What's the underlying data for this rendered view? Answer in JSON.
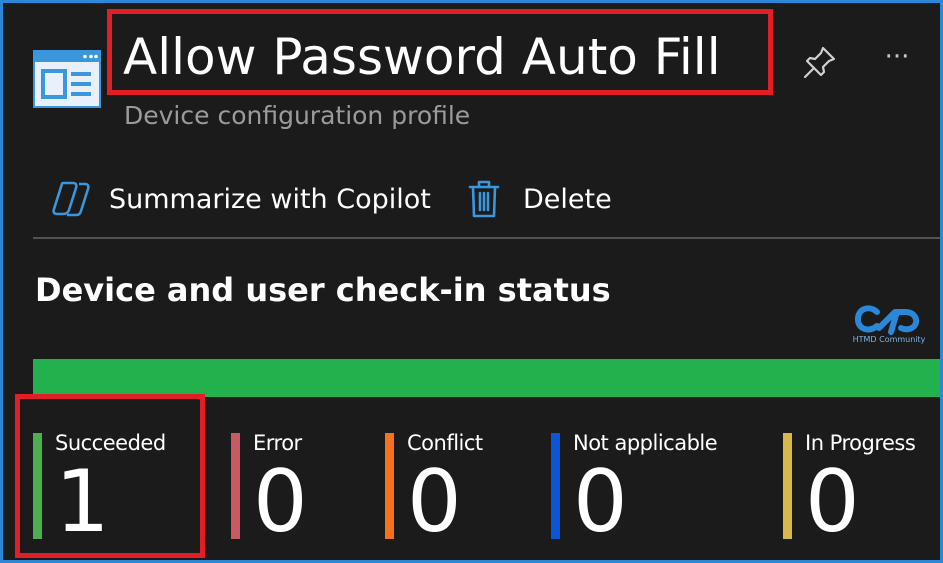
{
  "header": {
    "title": "Allow Password Auto Fill",
    "subtitle": "Device configuration profile",
    "more_label": "···",
    "icons": {
      "profile": "profile-document-icon",
      "pin": "pin-icon"
    }
  },
  "toolbar": {
    "copilot_label": "Summarize with Copilot",
    "delete_label": "Delete",
    "icons": {
      "copilot": "copilot-icon",
      "delete": "trash-icon"
    }
  },
  "status_section": {
    "title": "Device and user check-in status",
    "bar_fill_fraction": 1.0,
    "watermark_text": "HTMD Community",
    "stats": [
      {
        "label": "Succeeded",
        "value": "1",
        "color": "#4caf50"
      },
      {
        "label": "Error",
        "value": "0",
        "color": "#c85a63"
      },
      {
        "label": "Conflict",
        "value": "0",
        "color": "#f7721c"
      },
      {
        "label": "Not applicable",
        "value": "0",
        "color": "#0c55d6"
      },
      {
        "label": "In Progress",
        "value": "0",
        "color": "#d8b84a"
      }
    ]
  },
  "colors": {
    "background": "#1b1b1b",
    "frame_border": "#2b88d8",
    "highlight": "#e11f26",
    "status_bar": "#23b14d",
    "accent_icon": "#3a96dd"
  }
}
